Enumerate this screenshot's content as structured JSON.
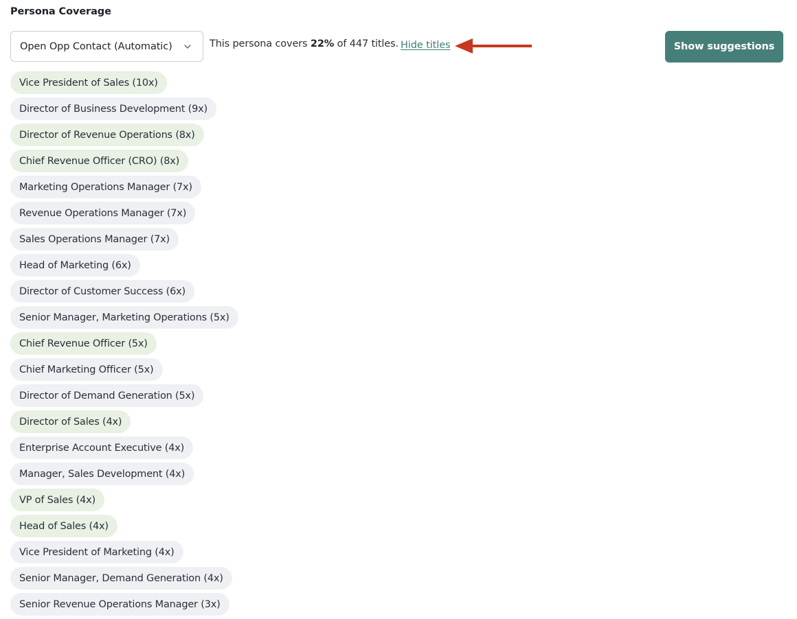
{
  "section": {
    "title": "Persona Coverage"
  },
  "persona_select": {
    "value": "Open Opp Contact (Automatic)",
    "icon": "chevron-down-icon"
  },
  "coverage": {
    "prefix": "This persona covers",
    "percent": "22%",
    "suffix": "of 447 titles.",
    "toggle_link": "Hide titles",
    "annotation_arrow_color": "#c8381f"
  },
  "actions": {
    "show_suggestions": "Show suggestions"
  },
  "colors": {
    "accent": "#467f78",
    "link": "#3b7f74",
    "covered_chip": "#e8f1e4",
    "uncovered_chip": "#eef0f4"
  },
  "titles": [
    {
      "label": "Vice President of Sales (10x)",
      "covered": true
    },
    {
      "label": "Director of Business Development (9x)",
      "covered": false
    },
    {
      "label": "Director of Revenue Operations (8x)",
      "covered": true
    },
    {
      "label": "Chief Revenue Officer (CRO) (8x)",
      "covered": true
    },
    {
      "label": "Marketing Operations Manager (7x)",
      "covered": false
    },
    {
      "label": "Revenue Operations Manager (7x)",
      "covered": false
    },
    {
      "label": "Sales Operations Manager (7x)",
      "covered": false
    },
    {
      "label": "Head of Marketing (6x)",
      "covered": false
    },
    {
      "label": "Director of Customer Success (6x)",
      "covered": false
    },
    {
      "label": "Senior Manager, Marketing Operations (5x)",
      "covered": false
    },
    {
      "label": "Chief Revenue Officer (5x)",
      "covered": true
    },
    {
      "label": "Chief Marketing Officer (5x)",
      "covered": false
    },
    {
      "label": "Director of Demand Generation (5x)",
      "covered": false
    },
    {
      "label": "Director of Sales (4x)",
      "covered": true
    },
    {
      "label": "Enterprise Account Executive (4x)",
      "covered": false
    },
    {
      "label": "Manager, Sales Development (4x)",
      "covered": false
    },
    {
      "label": "VP of Sales (4x)",
      "covered": true
    },
    {
      "label": "Head of Sales (4x)",
      "covered": true
    },
    {
      "label": "Vice President of Marketing (4x)",
      "covered": false
    },
    {
      "label": "Senior Manager, Demand Generation (4x)",
      "covered": false
    },
    {
      "label": "Senior Revenue Operations Manager (3x)",
      "covered": false
    }
  ]
}
